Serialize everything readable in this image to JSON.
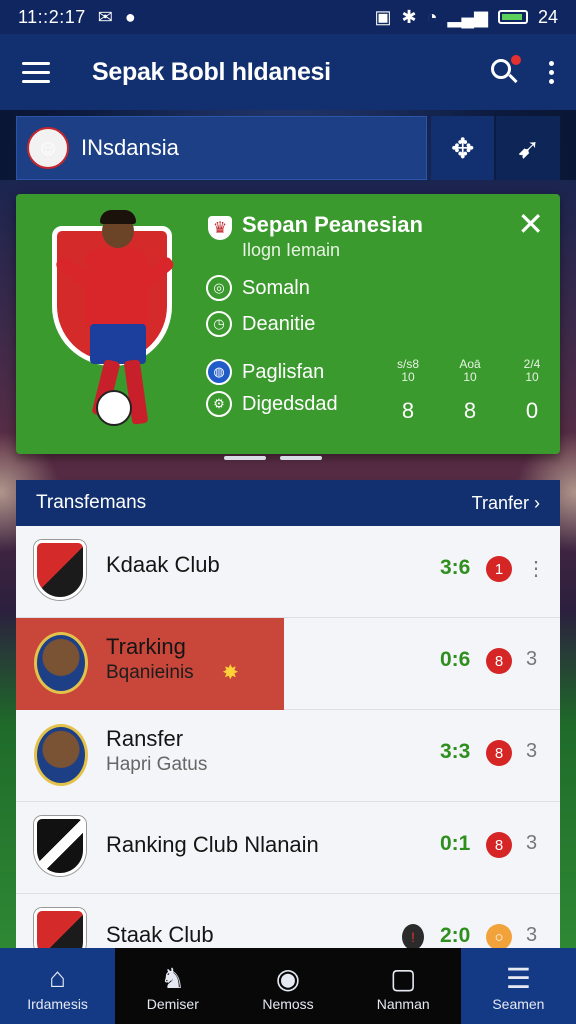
{
  "status_bar": {
    "time": "11::2:17",
    "battery": "24"
  },
  "app_bar": {
    "title": "Sepak Bobl hIdanesi"
  },
  "team_bar": {
    "team_name": "INsdansia"
  },
  "match_card": {
    "title": "Sepan Peanesian",
    "subtitle": "Ilogn Iemain",
    "stats": [
      {
        "label": "Somaln",
        "icon": "target-icon"
      },
      {
        "label": "Deanitie",
        "icon": "clock-icon"
      },
      {
        "label": "Paglisfan",
        "icon": "globe-icon"
      },
      {
        "label": "Digedsdad",
        "icon": "settings-icon"
      }
    ],
    "columns": [
      {
        "h1": "s/s8",
        "h2": "10",
        "value": "8"
      },
      {
        "h1": "Aoā",
        "h2": "10",
        "value": "8"
      },
      {
        "h1": "2/4",
        "h2": "10",
        "value": "0"
      }
    ]
  },
  "list_header": {
    "title": "Transfemans",
    "link": "Tranfer"
  },
  "rows": [
    {
      "title": "Kdaak Club",
      "subtitle": "",
      "score": "3:6",
      "pill": "1",
      "more": "⋮"
    },
    {
      "title": "Trarking",
      "subtitle": "Bqanieinis",
      "score": "0:6",
      "pill": "8",
      "more": "3"
    },
    {
      "title": "Ransfer",
      "subtitle": "Hapri Gatus",
      "score": "3:3",
      "pill": "8",
      "more": "3"
    },
    {
      "title": "Ranking Club Nlanain",
      "subtitle": "",
      "score": "0:1",
      "pill": "8",
      "more": "3"
    },
    {
      "title": "Staak Club",
      "subtitle": "",
      "score": "2:0",
      "pill": "",
      "more": "3"
    }
  ],
  "bottom_nav": [
    {
      "label": "Irdamesis",
      "icon": "home-icon"
    },
    {
      "label": "Demiser",
      "icon": "player-icon"
    },
    {
      "label": "Nemoss",
      "icon": "ball-icon"
    },
    {
      "label": "Nanman",
      "icon": "window-icon"
    },
    {
      "label": "Seamen",
      "icon": "menu-icon"
    }
  ],
  "colors": {
    "primary": "#12306f",
    "card_green": "#3b9a2e",
    "highlight": "#c9463a",
    "score_green": "#2f8f1e",
    "pill_red": "#d52525"
  }
}
